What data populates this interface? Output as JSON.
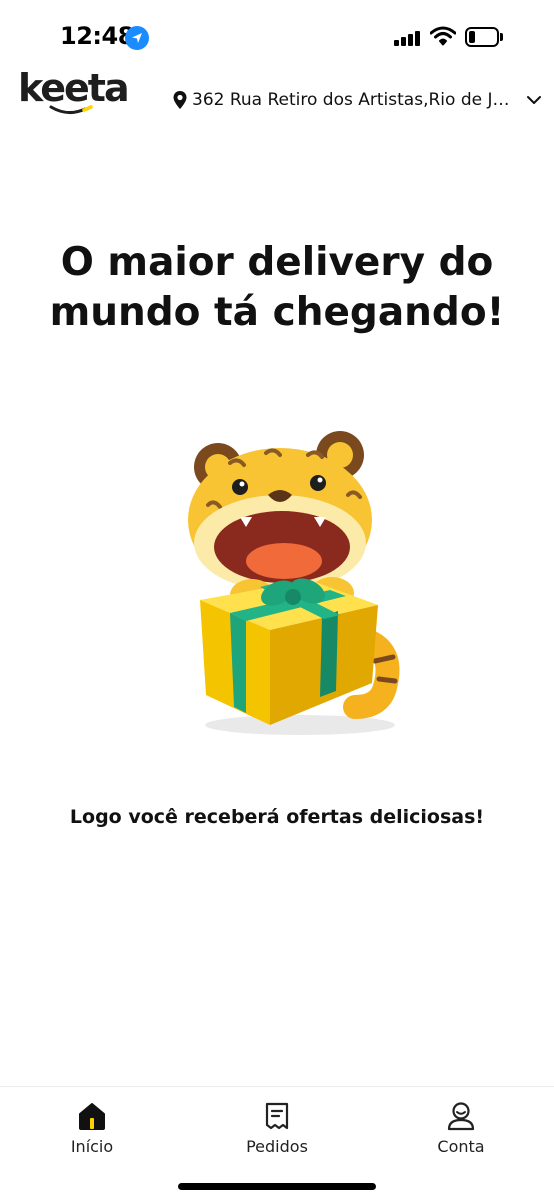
{
  "status_bar": {
    "time": "12:48",
    "icons": [
      "location-arrow-icon",
      "cellular-signal-icon",
      "wifi-icon",
      "battery-icon"
    ]
  },
  "header": {
    "logo_text": "keeta",
    "address": "362 Rua Retiro dos Artistas,Rio de Ja...",
    "icons": [
      "location-pin-icon",
      "chevron-down-icon"
    ]
  },
  "main": {
    "headline_line1": "O maior delivery do",
    "headline_line2": "mundo tá chegando!",
    "subtitle": "Logo você receberá ofertas deliciosas!"
  },
  "tabs": [
    {
      "label": "Início",
      "icon": "home-icon",
      "active": true
    },
    {
      "label": "Pedidos",
      "icon": "receipt-icon",
      "active": false
    },
    {
      "label": "Conta",
      "icon": "user-icon",
      "active": false
    }
  ],
  "colors": {
    "brand_yellow": "#FFD100",
    "brand_dark": "#1E1E1E",
    "ios_blue": "#1A8CFF",
    "gift_green": "#1FA57A"
  }
}
